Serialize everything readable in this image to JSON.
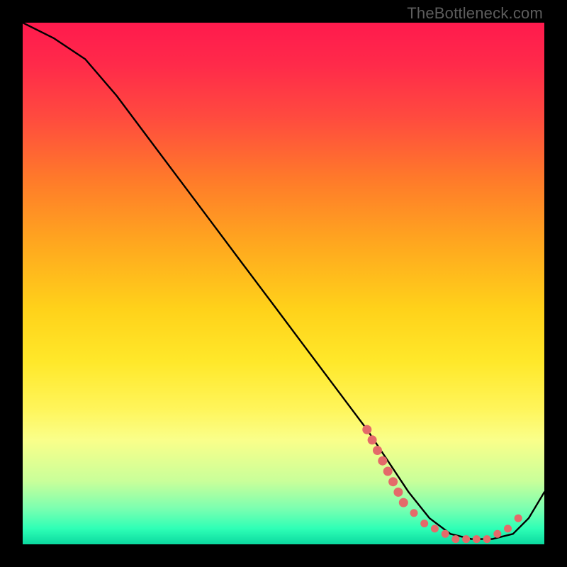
{
  "attribution": "TheBottleneck.com",
  "chart_data": {
    "type": "line",
    "title": "",
    "xlabel": "",
    "ylabel": "",
    "xlim": [
      0,
      100
    ],
    "ylim": [
      0,
      100
    ],
    "grid": false,
    "series": [
      {
        "name": "bottleneck-curve",
        "x": [
          0,
          6,
          12,
          18,
          24,
          30,
          36,
          42,
          48,
          54,
          60,
          66,
          70,
          74,
          78,
          82,
          86,
          90,
          94,
          97,
          100
        ],
        "values": [
          100,
          97,
          93,
          86,
          78,
          70,
          62,
          54,
          46,
          38,
          30,
          22,
          16,
          10,
          5,
          2,
          1,
          1,
          2,
          5,
          10
        ]
      }
    ],
    "markers": {
      "name": "highlight-points",
      "color": "#e46a6a",
      "x": [
        66,
        67,
        68,
        69,
        70,
        71,
        72,
        73,
        75,
        77,
        79,
        81,
        83,
        85,
        87,
        89,
        91,
        93,
        95
      ],
      "values": [
        22,
        20,
        18,
        16,
        14,
        12,
        10,
        8,
        6,
        4,
        3,
        2,
        1,
        1,
        1,
        1,
        2,
        3,
        5
      ]
    },
    "background": {
      "type": "vertical-gradient",
      "stops": [
        {
          "pos": 0,
          "color": "#ff1a4d"
        },
        {
          "pos": 50,
          "color": "#ffd21a"
        },
        {
          "pos": 80,
          "color": "#fff55a"
        },
        {
          "pos": 100,
          "color": "#0bd99f"
        }
      ]
    }
  }
}
